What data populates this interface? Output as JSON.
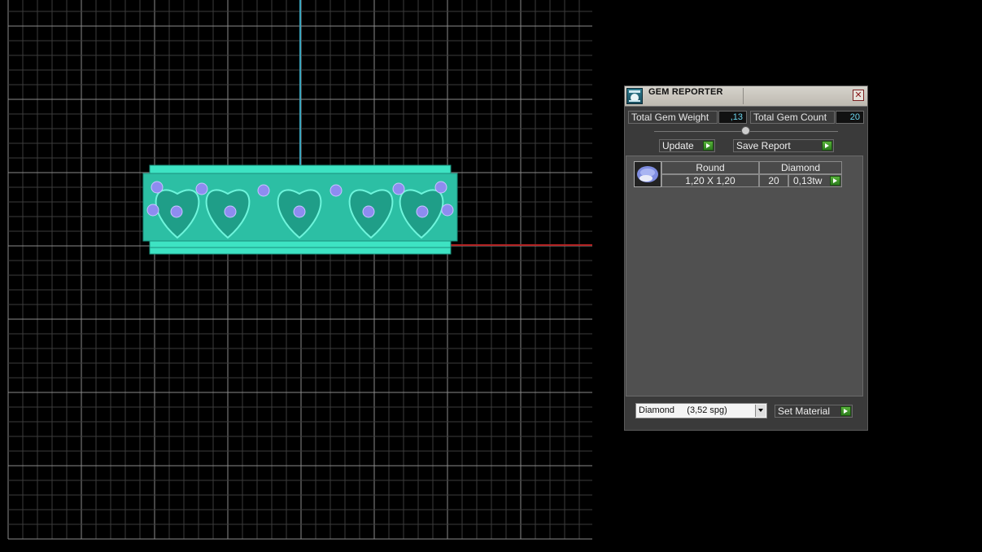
{
  "window": {
    "title": "GEM REPORTER",
    "close_symbol": "✕"
  },
  "totals": {
    "weight_label": "Total Gem Weight",
    "weight_value": ",13",
    "count_label": "Total Gem Count",
    "count_value": "20"
  },
  "buttons": {
    "update": "Update",
    "save_report": "Save Report",
    "set_material": "Set Material"
  },
  "gem_table": {
    "shape_header": "Round",
    "material_header": "Diamond",
    "size": "1,20 X 1,20",
    "count": "20",
    "weight": "0,13tw"
  },
  "material_select": {
    "value": "Diamond     (3,52 spg)"
  },
  "colors": {
    "model": "#3de3c3",
    "gem": "#8e8cf0",
    "grid": "#7a7a7a",
    "axis_y": "#3aa6bf",
    "axis_x": "#b32222",
    "go_button": "#3c9a28"
  },
  "icons": {
    "title": "gem-reporter-logo-icon",
    "row": "round-gem-icon",
    "go": "play-arrow-icon"
  }
}
